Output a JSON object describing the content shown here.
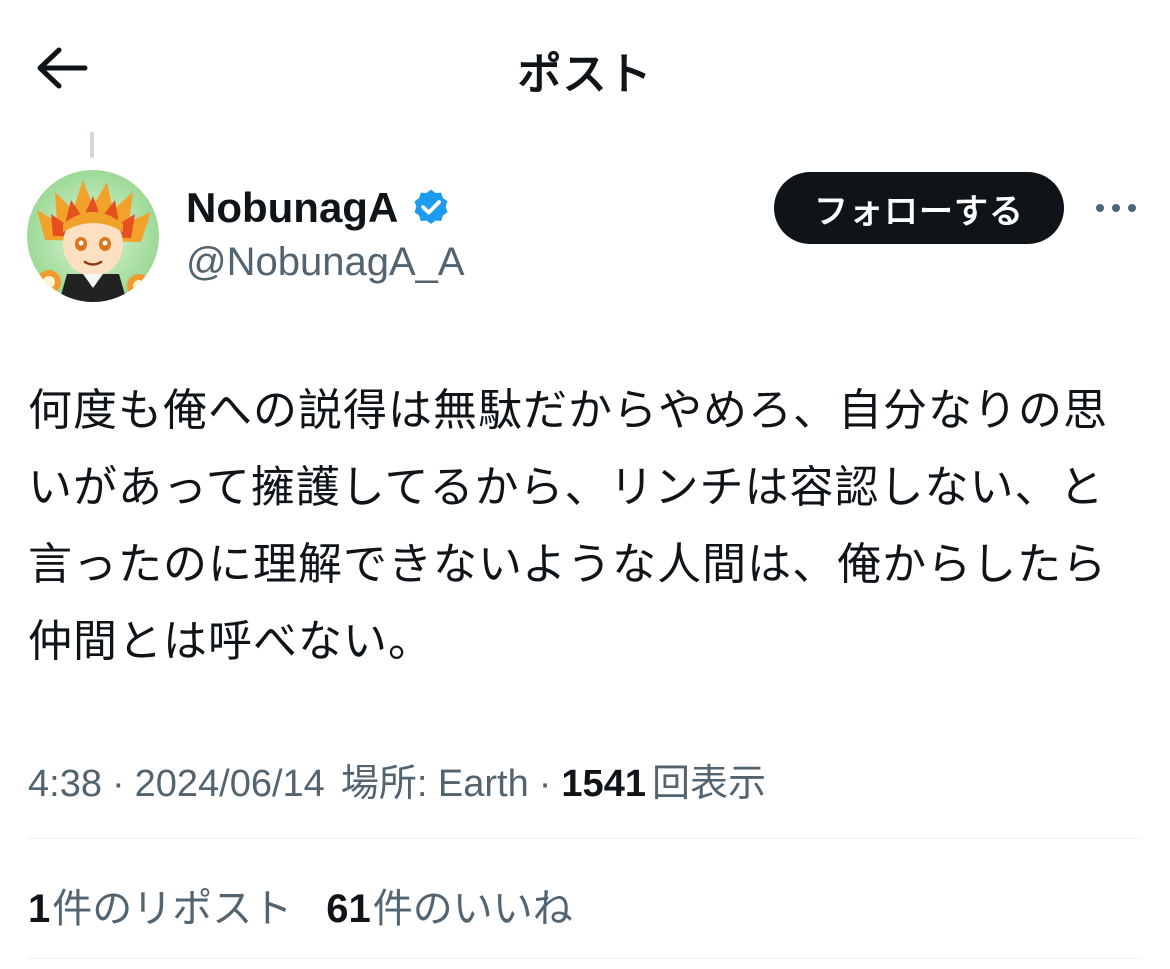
{
  "header": {
    "title": "ポスト",
    "back_icon": "arrow-left-icon"
  },
  "author": {
    "display_name": "NobunagA",
    "handle": "@NobunagA_A",
    "verified_icon": "verified-badge-icon",
    "verified_color": "#1d9bf0"
  },
  "follow_button": {
    "label": "フォローする"
  },
  "more_icon": "more-options-icon",
  "post": {
    "text": "何度も俺への説得は無駄だからやめろ、自分なりの思いがあって擁護してるから、リンチは容認しない、と言ったのに理解できないような人間は、俺からしたら仲間とは呼べない。"
  },
  "meta": {
    "time": "4:38",
    "date": "2024/06/14",
    "location": "場所: Earth",
    "views_count": "1541",
    "views_label": "回表示"
  },
  "stats": {
    "reposts_count": "1",
    "reposts_label": "件のリポスト",
    "likes_count": "61",
    "likes_label": "件のいいね"
  }
}
